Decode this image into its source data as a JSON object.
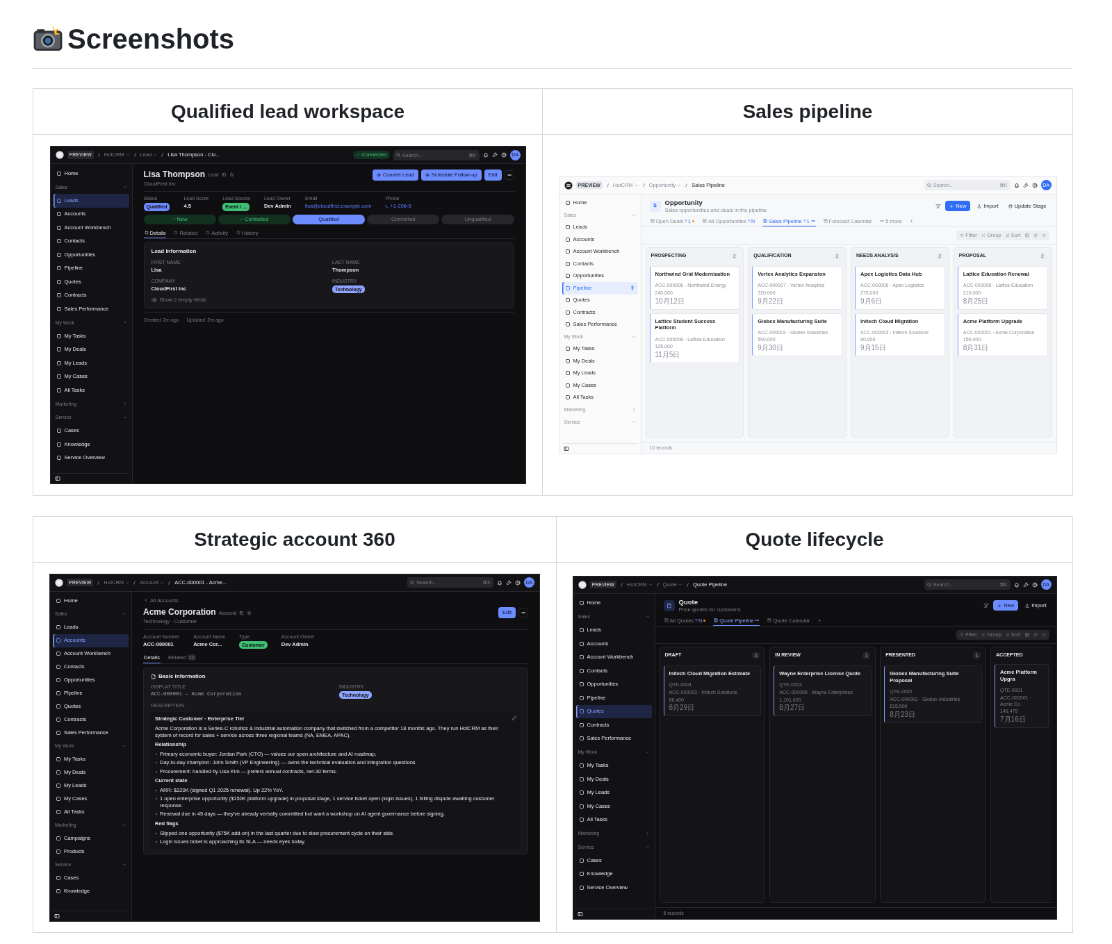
{
  "heading": "Screenshots",
  "tables": [
    {
      "cells": [
        {
          "title": "Qualified lead workspace",
          "screen": {
            "dark_mode": true,
            "topbar": {
              "preview": "PREVIEW",
              "breadcrumbs": [
                {
                  "label": "HotCRM",
                  "dropdown": true
                },
                {
                  "label": "Lead",
                  "dropdown": true
                },
                {
                  "label": "Lisa Thompson - Clo...",
                  "dropdown": false
                }
              ],
              "status": "Connected",
              "search_placeholder": "Search...",
              "shortcut": "⌘K",
              "avatar": "DA"
            },
            "sidebar": {
              "sections": [
                {
                  "items": [
                    {
                      "label": "Home",
                      "selected": false
                    }
                  ]
                },
                {
                  "label": "Sales",
                  "expanded": true,
                  "items": [
                    {
                      "label": "Leads",
                      "selected": true
                    },
                    {
                      "label": "Accounts",
                      "selected": false
                    },
                    {
                      "label": "Account Workbench",
                      "selected": false
                    },
                    {
                      "label": "Contacts",
                      "selected": false
                    },
                    {
                      "label": "Opportunities",
                      "selected": false
                    },
                    {
                      "label": "Pipeline",
                      "selected": false
                    },
                    {
                      "label": "Quotes",
                      "selected": false
                    },
                    {
                      "label": "Contracts",
                      "selected": false
                    },
                    {
                      "label": "Sales Performance",
                      "selected": false
                    }
                  ]
                },
                {
                  "label": "My Work",
                  "expanded": true,
                  "items": [
                    {
                      "label": "My Tasks",
                      "selected": false
                    },
                    {
                      "label": "My Deals",
                      "selected": false
                    },
                    {
                      "label": "My Leads",
                      "selected": false
                    },
                    {
                      "label": "My Cases",
                      "selected": false
                    },
                    {
                      "label": "All Tasks",
                      "selected": false
                    }
                  ]
                },
                {
                  "label": "Marketing",
                  "expanded": false
                },
                {
                  "label": "Service",
                  "expanded": true,
                  "items": [
                    {
                      "label": "Cases",
                      "selected": false
                    },
                    {
                      "label": "Knowledge",
                      "selected": false
                    },
                    {
                      "label": "Service Overview",
                      "selected": false
                    }
                  ]
                }
              ]
            },
            "main": {
              "kind": "record",
              "title": "Lisa Thompson",
              "type_label": "Lead",
              "subtitle": "CloudFirst Inc",
              "actions": [
                {
                  "label": "Convert Lead",
                  "kind": "with_icon"
                },
                {
                  "label": "Schedule Follow-up",
                  "kind": "with_icon"
                },
                {
                  "label": "Edit",
                  "kind": "plain"
                }
              ],
              "fields": [
                {
                  "label": "Status",
                  "value": "Qualified",
                  "kind": "badge",
                  "color": "#6d8cff"
                },
                {
                  "label": "Lead Score",
                  "value": "4.5",
                  "kind": "text"
                },
                {
                  "label": "Lead Source",
                  "value": "Event / ...",
                  "kind": "badge",
                  "color": "#3fbf74"
                },
                {
                  "label": "Lead Owner",
                  "value": "Dev Admin",
                  "kind": "text"
                },
                {
                  "label": "Email",
                  "value": "lisa@cloudfirst.example.com",
                  "kind": "link"
                },
                {
                  "label": "Phone",
                  "value": "+1-206-5",
                  "kind": "phone"
                }
              ],
              "stages": [
                {
                  "label": "New",
                  "completed": true,
                  "selected": false
                },
                {
                  "label": "Contacted",
                  "completed": true,
                  "selected": false
                },
                {
                  "label": "Qualified",
                  "completed": false,
                  "selected": true
                },
                {
                  "label": "Converted",
                  "completed": false,
                  "selected": false
                },
                {
                  "label": "Unqualified",
                  "completed": false,
                  "selected": false
                }
              ],
              "tab_icons": true,
              "tabs": [
                {
                  "label": "Details",
                  "selected": true
                },
                {
                  "label": "Related",
                  "selected": false
                },
                {
                  "label": "Activity",
                  "selected": false
                },
                {
                  "label": "History",
                  "selected": false
                }
              ],
              "card": {
                "title": "Lead Information",
                "title_icon": false,
                "fields": [
                  {
                    "label": "FIRST NAME",
                    "value": "Lisa",
                    "kind": "text"
                  },
                  {
                    "label": "LAST NAME",
                    "value": "Thompson",
                    "kind": "text"
                  },
                  {
                    "label": "COMPANY",
                    "value": "CloudFirst Inc",
                    "kind": "text"
                  },
                  {
                    "label": "INDUSTRY",
                    "value": "Technology",
                    "kind": "badge",
                    "color": "#8fa4ff"
                  }
                ],
                "empty_fields_link": "Show 2 empty fields"
              },
              "footer": [
                {
                  "label": "Created",
                  "value": "2m ago"
                },
                {
                  "label": "Updated",
                  "value": "2m ago"
                }
              ]
            }
          }
        },
        {
          "title": "Sales pipeline",
          "screen": {
            "dark_mode": false,
            "topbar": {
              "preview": "PREVIEW",
              "breadcrumbs": [
                {
                  "label": "HotCRM",
                  "dropdown": true
                },
                {
                  "label": "Opportunity",
                  "dropdown": true
                },
                {
                  "label": "Sales Pipeline",
                  "dropdown": false
                }
              ],
              "search_placeholder": "Search...",
              "shortcut": "⌘K",
              "avatar": "DA"
            },
            "sidebar": {
              "sections": [
                {
                  "items": [
                    {
                      "label": "Home",
                      "selected": false
                    }
                  ]
                },
                {
                  "label": "Sales",
                  "expanded": true,
                  "items": [
                    {
                      "label": "Leads",
                      "selected": false
                    },
                    {
                      "label": "Accounts",
                      "selected": false
                    },
                    {
                      "label": "Account Workbench",
                      "selected": false
                    },
                    {
                      "label": "Contacts",
                      "selected": false
                    },
                    {
                      "label": "Opportunities",
                      "selected": false
                    },
                    {
                      "label": "Pipeline",
                      "selected": true,
                      "pinned": true
                    },
                    {
                      "label": "Quotes",
                      "selected": false
                    },
                    {
                      "label": "Contracts",
                      "selected": false
                    },
                    {
                      "label": "Sales Performance",
                      "selected": false
                    }
                  ]
                },
                {
                  "label": "My Work",
                  "expanded": true,
                  "items": [
                    {
                      "label": "My Tasks",
                      "selected": false
                    },
                    {
                      "label": "My Deals",
                      "selected": false
                    },
                    {
                      "label": "My Leads",
                      "selected": false
                    },
                    {
                      "label": "My Cases",
                      "selected": false
                    },
                    {
                      "label": "All Tasks",
                      "selected": false
                    }
                  ]
                },
                {
                  "label": "Marketing",
                  "expanded": false
                },
                {
                  "label": "Service",
                  "expanded": true
                }
              ]
            },
            "main": {
              "kind": "board",
              "icon_text": "$",
              "title": "Opportunity",
              "subtitle": "Sales opportunities and deals in the pipeline",
              "actions": [
                {
                  "kind": "icon"
                },
                {
                  "label": "New",
                  "kind": "primary"
                },
                {
                  "label": "Import",
                  "kind": "upload"
                },
                {
                  "label": "Update Stage",
                  "kind": "stage"
                }
              ],
              "views": [
                {
                  "label": "Open Deals",
                  "kind": "table",
                  "filter_count": "1",
                  "unsaved": true,
                  "dropdown": false,
                  "selected": false
                },
                {
                  "label": "All Opportunities",
                  "kind": "table",
                  "filter_count": "N",
                  "unsaved": false,
                  "dropdown": false,
                  "selected": false
                },
                {
                  "label": "Sales Pipeline",
                  "kind": "board",
                  "filter_count": "1",
                  "unsaved": false,
                  "dropdown": true,
                  "selected": true
                },
                {
                  "label": "Forecast Calendar",
                  "kind": "calendar",
                  "unsaved": false,
                  "dropdown": false,
                  "selected": false
                }
              ],
              "more_views": "5 more",
              "add_label": "+",
              "toolbar": [
                {
                  "label": "Filter",
                  "kind": "filter"
                },
                {
                  "label": "Group",
                  "kind": "group"
                },
                {
                  "label": "Sort",
                  "kind": "sort"
                }
              ],
              "columns": [
                {
                  "title": "PROSPECTING",
                  "count": "2",
                  "cards": [
                    {
                      "title": "Northwind Grid Modernization",
                      "account": "ACC-000006 · Northwind Energy",
                      "amount": "240,000",
                      "date": "10月12日"
                    },
                    {
                      "title": "Lattice Student Success Platform",
                      "account": "ACC-000008 · Lattice Education",
                      "amount": "125,000",
                      "date": "11月5日"
                    }
                  ]
                },
                {
                  "title": "QUALIFICATION",
                  "count": "2",
                  "cards": [
                    {
                      "title": "Vertex Analytics Expansion",
                      "account": "ACC-000007 · Vertex Analytics",
                      "amount": "320,000",
                      "date": "9月22日"
                    },
                    {
                      "title": "Globex Manufacturing Suite",
                      "account": "ACC-000002 · Globex Industries",
                      "amount": "500,000",
                      "date": "9月30日"
                    }
                  ]
                },
                {
                  "title": "NEEDS ANALYSIS",
                  "count": "2",
                  "cards": [
                    {
                      "title": "Apex Logistics Data Hub",
                      "account": "ACC-000009 · Apex Logistics",
                      "amount": "275,000",
                      "date": "9月6日"
                    },
                    {
                      "title": "Initech Cloud Migration",
                      "account": "ACC-000003 · Initech Solutions",
                      "amount": "80,000",
                      "date": "9月15日"
                    }
                  ]
                },
                {
                  "title": "PROPOSAL",
                  "count": "2",
                  "cards": [
                    {
                      "title": "Lattice Education Renewal",
                      "account": "ACC-000008 · Lattice Education",
                      "amount": "210,000",
                      "date": "8月25日"
                    },
                    {
                      "title": "Acme Platform Upgrade",
                      "account": "ACC-000001 · Acme Corporation",
                      "amount": "150,000",
                      "date": "8月31日"
                    }
                  ]
                }
              ],
              "footer": "10 records"
            }
          }
        }
      ]
    },
    {
      "cells": [
        {
          "title": "Strategic account 360",
          "screen": {
            "dark_mode": true,
            "topbar": {
              "preview": "PREVIEW",
              "breadcrumbs": [
                {
                  "label": "HotCRM",
                  "dropdown": true
                },
                {
                  "label": "Account",
                  "dropdown": true
                },
                {
                  "label": "ACC-000001 - Acme...",
                  "dropdown": false
                }
              ],
              "search_placeholder": "Search...",
              "shortcut": "⌘K",
              "avatar": "DA"
            },
            "sidebar": {
              "sections": [
                {
                  "items": [
                    {
                      "label": "Home",
                      "selected": false
                    }
                  ]
                },
                {
                  "label": "Sales",
                  "expanded": true,
                  "items": [
                    {
                      "label": "Leads",
                      "selected": false
                    },
                    {
                      "label": "Accounts",
                      "selected": true
                    },
                    {
                      "label": "Account Workbench",
                      "selected": false
                    },
                    {
                      "label": "Contacts",
                      "selected": false
                    },
                    {
                      "label": "Opportunities",
                      "selected": false
                    },
                    {
                      "label": "Pipeline",
                      "selected": false
                    },
                    {
                      "label": "Quotes",
                      "selected": false
                    },
                    {
                      "label": "Contracts",
                      "selected": false
                    },
                    {
                      "label": "Sales Performance",
                      "selected": false
                    }
                  ]
                },
                {
                  "label": "My Work",
                  "expanded": true,
                  "items": [
                    {
                      "label": "My Tasks",
                      "selected": false
                    },
                    {
                      "label": "My Deals",
                      "selected": false
                    },
                    {
                      "label": "My Leads",
                      "selected": false
                    },
                    {
                      "label": "My Cases",
                      "selected": false
                    },
                    {
                      "label": "All Tasks",
                      "selected": false
                    }
                  ]
                },
                {
                  "label": "Marketing",
                  "expanded": true,
                  "items": [
                    {
                      "label": "Campaigns",
                      "selected": false
                    },
                    {
                      "label": "Products",
                      "selected": false
                    }
                  ]
                },
                {
                  "label": "Service",
                  "expanded": true,
                  "items": [
                    {
                      "label": "Cases",
                      "selected": false
                    },
                    {
                      "label": "Knowledge",
                      "selected": false
                    }
                  ]
                }
              ]
            },
            "main": {
              "kind": "record",
              "back": "All Accounts",
              "title": "Acme Corporation",
              "type_label": "Account",
              "subtitle": "Technology · Customer",
              "actions": [
                {
                  "label": "Edit",
                  "kind": "plain"
                }
              ],
              "fields": [
                {
                  "label": "Account Number",
                  "value": "ACC-000001",
                  "kind": "text"
                },
                {
                  "label": "Account Name",
                  "value": "Acme Cor...",
                  "kind": "text"
                },
                {
                  "label": "Type",
                  "value": "Customer",
                  "kind": "badge",
                  "color": "#3fbf74"
                },
                {
                  "label": "Account Owner",
                  "value": "Dev Admin",
                  "kind": "text"
                }
              ],
              "tab_icons": false,
              "tabs": [
                {
                  "label": "Details",
                  "selected": true
                },
                {
                  "label": "Related",
                  "count": "22",
                  "selected": false
                }
              ],
              "card": {
                "title": "Basic Information",
                "title_icon": true,
                "fields": [
                  {
                    "label": "DISPLAY TITLE",
                    "value": "ACC-000001 — Acme Corporation",
                    "kind": "mono"
                  },
                  {
                    "label": "INDUSTRY",
                    "value": "Technology",
                    "kind": "badge",
                    "color": "#8fa4ff"
                  }
                ],
                "description": {
                  "label": "DESCRIPTION",
                  "blocks": [
                    {
                      "kind": "heading",
                      "text": "Strategic Customer · Enterprise Tier"
                    },
                    {
                      "kind": "paragraph",
                      "text": "Acme Corporation is a Series-C robotics & industrial automation company that switched from a competitor 18 months ago. They run HotCRM as their system of record for sales + service across three regional teams (NA, EMEA, APAC)."
                    },
                    {
                      "kind": "heading",
                      "text": "Relationship"
                    },
                    {
                      "kind": "bullets",
                      "items": [
                        "Primary economic buyer: Jordan Park (CTO) — values our open architecture and AI roadmap.",
                        "Day-to-day champion: John Smith (VP Engineering) — owns the technical evaluation and integration questions.",
                        "Procurement: handled by Lisa Kim — prefers annual contracts, net-30 terms."
                      ]
                    },
                    {
                      "kind": "heading",
                      "text": "Current state"
                    },
                    {
                      "kind": "bullets",
                      "items": [
                        "ARR: $220K (signed Q1 2025 renewal). Up 22% YoY.",
                        "1 open enterprise opportunity ($150K platform upgrade) in proposal stage, 1 service ticket open (login issues), 1 billing dispute awaiting customer response.",
                        "Renewal due in 45 days — they've already verbally committed but want a workshop on AI agent governance before signing."
                      ]
                    },
                    {
                      "kind": "heading",
                      "text": "Red flags"
                    },
                    {
                      "kind": "bullets",
                      "items": [
                        "Slipped one opportunity ($75K add-on) in the last quarter due to slow procurement cycle on their side.",
                        "Login issues ticket is approaching its SLA — needs eyes today."
                      ]
                    }
                  ]
                }
              }
            }
          }
        },
        {
          "title": "Quote lifecycle",
          "screen": {
            "dark_mode": true,
            "topbar": {
              "preview": "PREVIEW",
              "breadcrumbs": [
                {
                  "label": "HotCRM",
                  "dropdown": true
                },
                {
                  "label": "Quote",
                  "dropdown": true
                },
                {
                  "label": "Quote Pipeline",
                  "dropdown": false
                }
              ],
              "search_placeholder": "Search...",
              "shortcut": "⌘K",
              "avatar": "DA"
            },
            "sidebar": {
              "sections": [
                {
                  "items": [
                    {
                      "label": "Home",
                      "selected": false
                    }
                  ]
                },
                {
                  "label": "Sales",
                  "expanded": true,
                  "items": [
                    {
                      "label": "Leads",
                      "selected": false
                    },
                    {
                      "label": "Accounts",
                      "selected": false
                    },
                    {
                      "label": "Account Workbench",
                      "selected": false
                    },
                    {
                      "label": "Contacts",
                      "selected": false
                    },
                    {
                      "label": "Opportunities",
                      "selected": false
                    },
                    {
                      "label": "Pipeline",
                      "selected": false
                    },
                    {
                      "label": "Quotes",
                      "selected": true
                    },
                    {
                      "label": "Contracts",
                      "selected": false
                    },
                    {
                      "label": "Sales Performance",
                      "selected": false
                    }
                  ]
                },
                {
                  "label": "My Work",
                  "expanded": true,
                  "items": [
                    {
                      "label": "My Tasks",
                      "selected": false
                    },
                    {
                      "label": "My Deals",
                      "selected": false
                    },
                    {
                      "label": "My Leads",
                      "selected": false
                    },
                    {
                      "label": "My Cases",
                      "selected": false
                    },
                    {
                      "label": "All Tasks",
                      "selected": false
                    }
                  ]
                },
                {
                  "label": "Marketing",
                  "expanded": false
                },
                {
                  "label": "Service",
                  "expanded": true,
                  "items": [
                    {
                      "label": "Cases",
                      "selected": false
                    },
                    {
                      "label": "Knowledge",
                      "selected": false
                    },
                    {
                      "label": "Service Overview",
                      "selected": false
                    }
                  ]
                }
              ]
            },
            "main": {
              "kind": "board",
              "title": "Quote",
              "subtitle": "Price quotes for customers",
              "actions": [
                {
                  "kind": "icon"
                },
                {
                  "label": "New",
                  "kind": "primary"
                },
                {
                  "label": "Import",
                  "kind": "upload"
                }
              ],
              "views": [
                {
                  "label": "All Quotes",
                  "kind": "table",
                  "filter_count": "N",
                  "unsaved": true,
                  "dropdown": false,
                  "selected": false
                },
                {
                  "label": "Quote Pipeline",
                  "kind": "board",
                  "unsaved": false,
                  "dropdown": true,
                  "selected": true
                },
                {
                  "label": "Quote Calendar",
                  "kind": "calendar",
                  "unsaved": false,
                  "dropdown": false,
                  "selected": false
                }
              ],
              "add_label": "+",
              "toolbar": [
                {
                  "label": "Filter",
                  "kind": "filter"
                },
                {
                  "label": "Group",
                  "kind": "group"
                },
                {
                  "label": "Sort",
                  "kind": "sort"
                }
              ],
              "columns": [
                {
                  "title": "DRAFT",
                  "count": "1",
                  "cards": [
                    {
                      "title": "Initech Cloud Migration Estimate",
                      "code": "QTE-0004",
                      "account": "ACC-000003 · Initech Solutions",
                      "amount": "86,400",
                      "date": "8月29日"
                    }
                  ]
                },
                {
                  "title": "IN REVIEW",
                  "count": "1",
                  "cards": [
                    {
                      "title": "Wayne Enterprise License Quote",
                      "code": "QTE-0003",
                      "account": "ACC-000005 · Wayne Enterprises",
                      "amount": "1,101,600",
                      "date": "8月27日"
                    }
                  ]
                },
                {
                  "title": "PRESENTED",
                  "count": "1",
                  "cards": [
                    {
                      "title": "Globex Manufacturing Suite Proposal",
                      "code": "QTE-0002",
                      "account": "ACC-000002 · Globex Industries",
                      "amount": "515,500",
                      "date": "8月23日"
                    }
                  ]
                },
                {
                  "title": "ACCEPTED",
                  "cards": [
                    {
                      "title": "Acme Platform Upgra",
                      "code": "QTE-0001",
                      "account": "ACC-000001 · Acme Co",
                      "amount": "146,475",
                      "date": "7月16日"
                    }
                  ]
                }
              ],
              "footer": "5 records"
            }
          }
        }
      ]
    }
  ]
}
